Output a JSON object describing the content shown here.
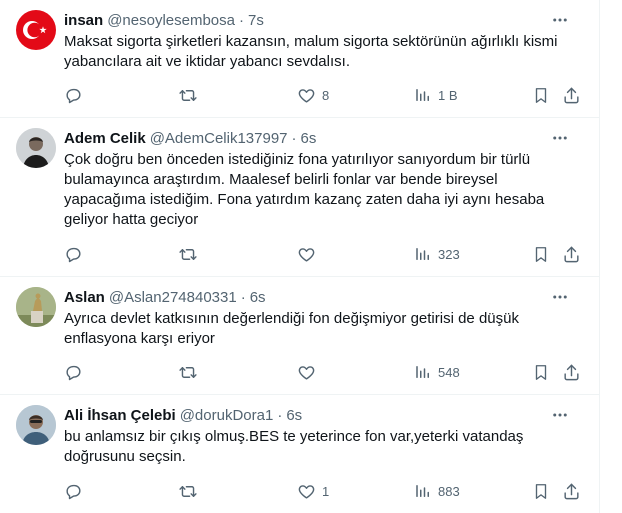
{
  "tweets": [
    {
      "name": "insan",
      "handle": "@nesoylesembosa",
      "sep": "·",
      "time": "7s",
      "text": "Maksat sigorta şirketleri kazansın, malum sigorta sektörünün ağırlıklı kismi yabancılara ait ve iktidar yabancı sevdalısı.",
      "likes": "8",
      "views": "1 B"
    },
    {
      "name": "Adem Celik",
      "handle": "@AdemCelik137997",
      "sep": "·",
      "time": "6s",
      "text": "Çok doğru ben önceden istediğiniz fona yatırılıyor sanıyordum bir türlü bulamayınca araştırdım. Maalesef belirli fonlar var bende bireysel yapacağıma istediğim. Fona yatırdım kazanç zaten daha iyi aynı hesaba geliyor hatta geciyor",
      "likes": "",
      "views": "323"
    },
    {
      "name": "Aslan",
      "handle": "@Aslan274840331",
      "sep": "·",
      "time": "6s",
      "text": "Ayrıca devlet katkısının değerlendiği fon değişmiyor getirisi de düşük enflasyona karşı eriyor",
      "likes": "",
      "views": "548"
    },
    {
      "name": "Ali İhsan Çelebi",
      "handle": "@dorukDora1",
      "sep": "·",
      "time": "6s",
      "text": "bu anlamsız bir çıkış olmuş.BES te yeterince fon var,yeterki vatandaş doğrusunu seçsin.",
      "likes": "1",
      "views": "883"
    }
  ],
  "colors": {
    "text": "#0f1419",
    "muted": "#536471",
    "divider": "#eff3f4",
    "flag_red": "#e30a17"
  },
  "icons": [
    "more-icon",
    "reply-icon",
    "retweet-icon",
    "like-icon",
    "views-icon",
    "bookmark-icon",
    "share-icon"
  ]
}
